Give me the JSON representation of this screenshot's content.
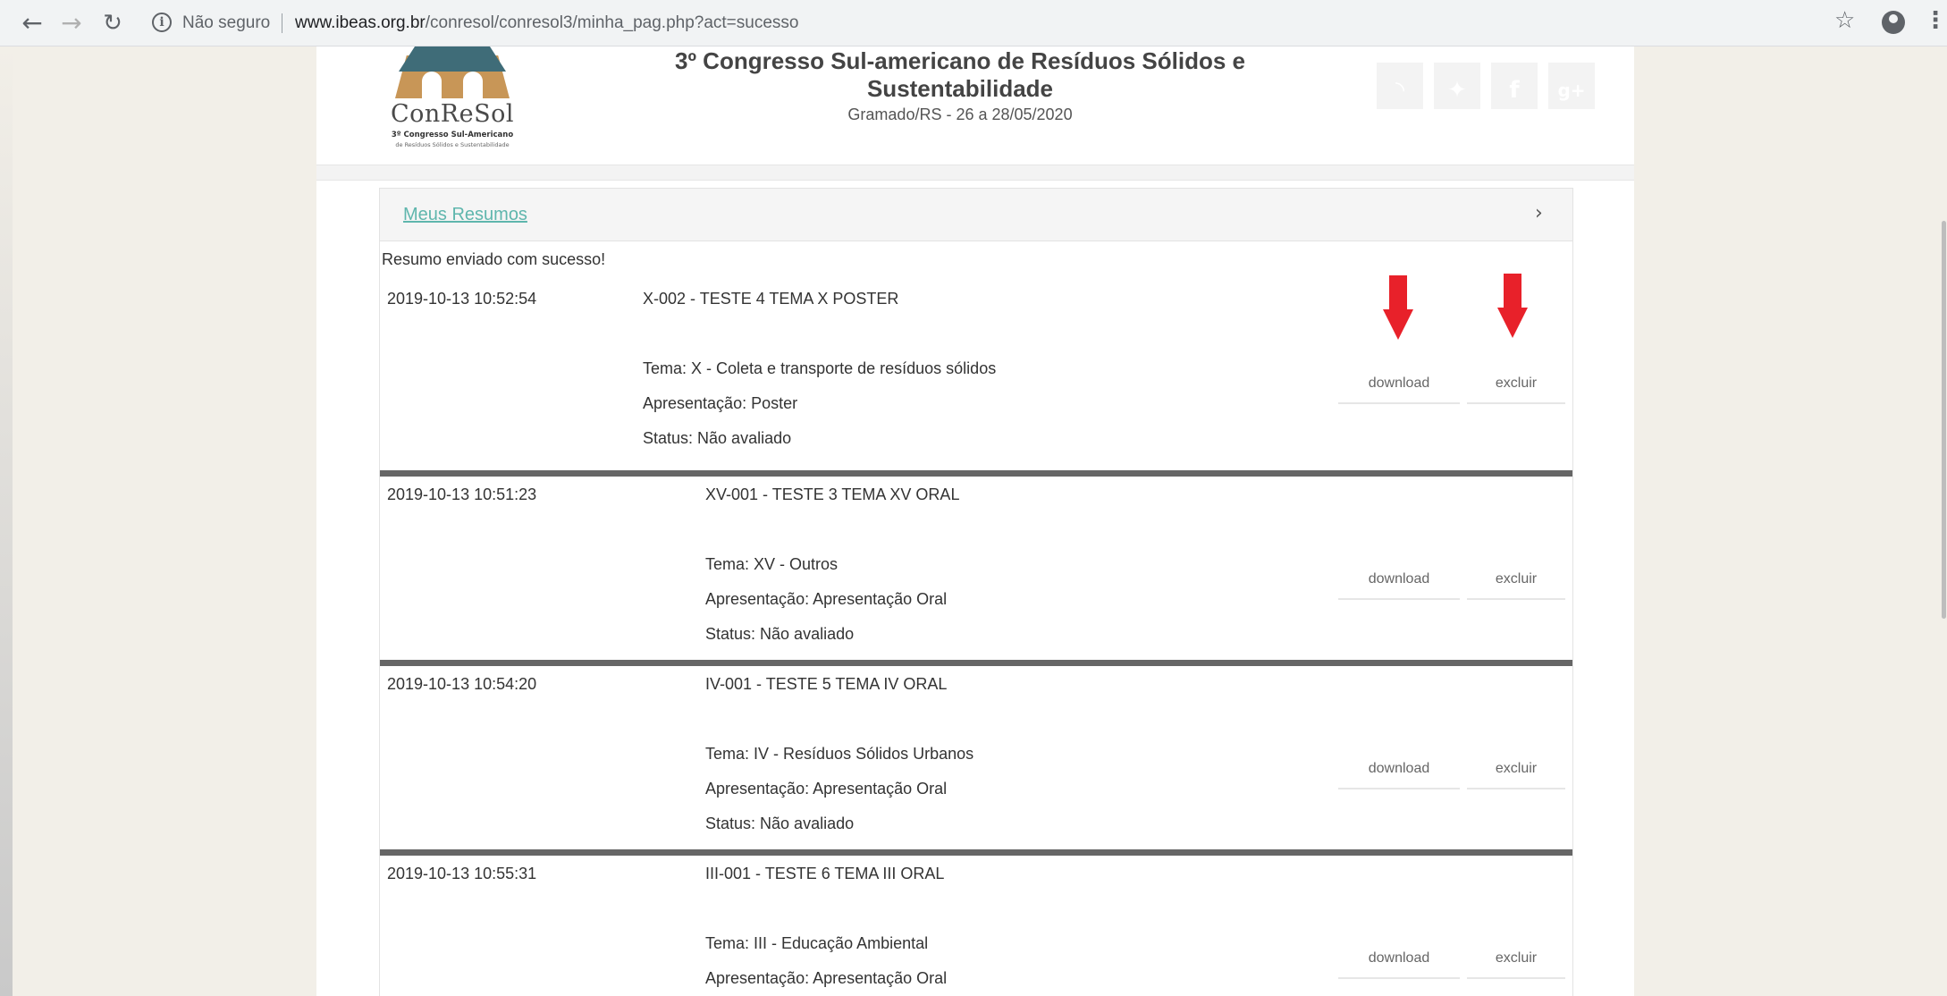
{
  "browser": {
    "security_label": "Não seguro",
    "url_host": "www.ibeas.org.br",
    "url_path": "/conresol/conresol3/minha_pag.php?act=sucesso"
  },
  "header": {
    "logo": {
      "brand": "ConReSol",
      "tagline": "3º Congresso Sul-Americano",
      "subtagline": "de Resíduos Sólidos e Sustentabilidade"
    },
    "title_line1": "3º Congresso Sul-americano de Resíduos Sólidos e",
    "title_line2": "Sustentabilidade",
    "subtitle": "Gramado/RS - 26 a 28/05/2020",
    "social_icons": [
      "rss-icon",
      "twitter-icon",
      "facebook-icon",
      "google-plus-icon"
    ]
  },
  "panel": {
    "title": "Meus Resumos",
    "success_message": "Resumo enviado com sucesso!",
    "download_label": "download",
    "delete_label": "excluir",
    "entries": [
      {
        "date": "2019-10-13 10:52:54",
        "title": "X-002 - TESTE 4 TEMA X POSTER",
        "tema": "Tema: X - Coleta e transporte de resíduos sólidos",
        "apresentacao": "Apresentação: Poster",
        "status": "Status: Não avaliado"
      },
      {
        "date": "2019-10-13 10:51:23",
        "title": "XV-001 - TESTE 3 TEMA XV ORAL",
        "tema": "Tema: XV - Outros",
        "apresentacao": "Apresentação: Apresentação Oral",
        "status": "Status: Não avaliado"
      },
      {
        "date": "2019-10-13 10:54:20",
        "title": "IV-001 - TESTE 5 TEMA IV ORAL",
        "tema": "Tema: IV - Resíduos Sólidos Urbanos",
        "apresentacao": "Apresentação: Apresentação Oral",
        "status": "Status: Não avaliado"
      },
      {
        "date": "2019-10-13 10:55:31",
        "title": "III-001 - TESTE 6 TEMA III ORAL",
        "tema": "Tema: III - Educação Ambiental",
        "apresentacao": "Apresentação: Apresentação Oral",
        "status": ""
      }
    ]
  },
  "colors": {
    "accent_link": "#5fb6ad",
    "annotation_arrow": "#e8212a",
    "separator": "#666666"
  }
}
